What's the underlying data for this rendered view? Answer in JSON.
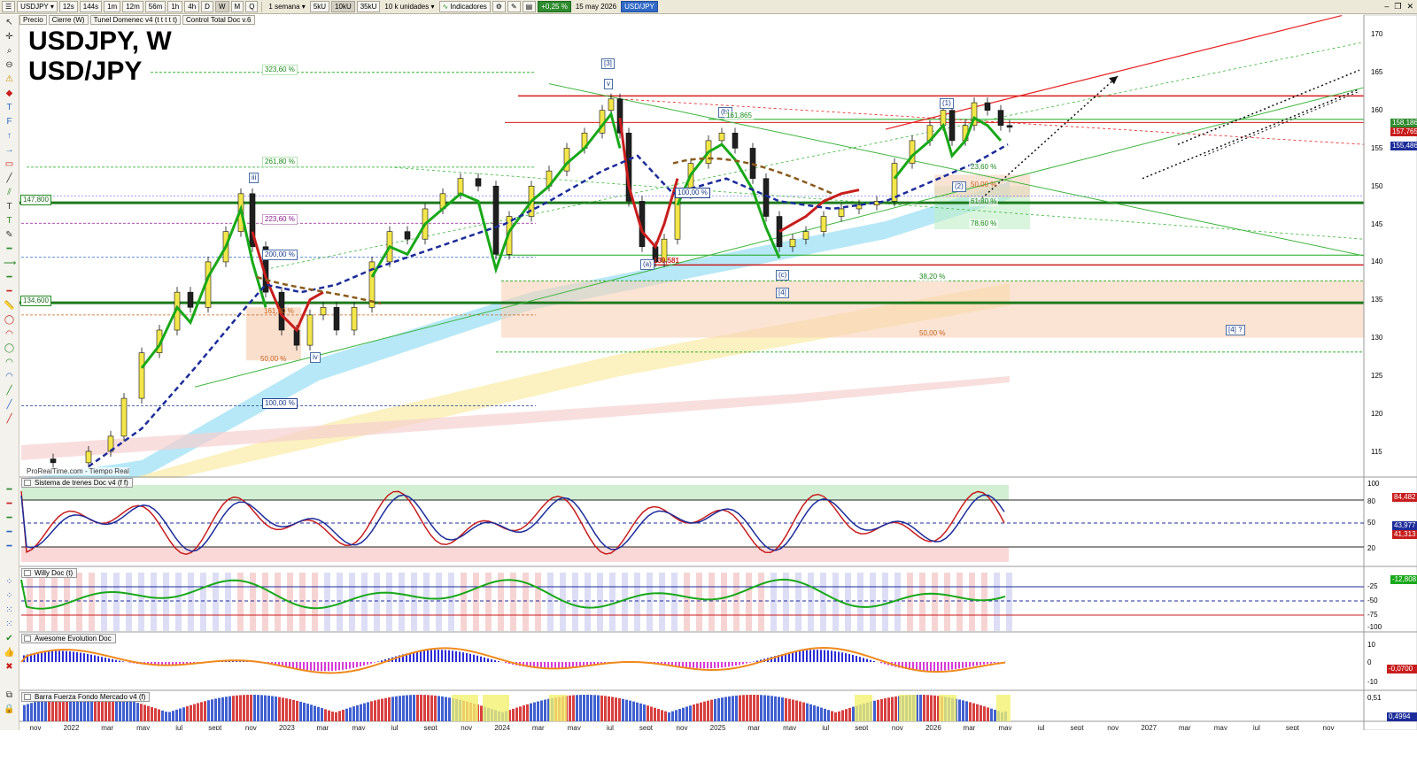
{
  "toolbar": {
    "symbol": "USDJPY",
    "timeframes": [
      "12s",
      "144s",
      "1m",
      "12m",
      "56m",
      "1h",
      "4h",
      "D",
      "W",
      "M",
      "Q"
    ],
    "active_timeframe": "W",
    "period": "1 semana",
    "tick_buttons": [
      "5kU",
      "10kU",
      "35kU"
    ],
    "active_tick": "10kU",
    "units": "10 k unidades",
    "indicators_label": "Indicadores",
    "change_badge": "+0,25 %",
    "date": "15 may 2026",
    "symbol_badge": "USD/JPY",
    "win_controls": [
      "–",
      "❐",
      "✕"
    ]
  },
  "legend": {
    "items": [
      "Precio",
      "Cierre (W)",
      "Tunel Domenec v4 (t t t t t)",
      "Control Total Doc v.6"
    ]
  },
  "title": {
    "line1": "USDJPY, W",
    "line2": "USD/JPY"
  },
  "source_label": "ProRealTime.com - Tiempo Real",
  "colors": {
    "up_candle": "#f3e64a",
    "down_candle": "#1f1f1f",
    "green_line": "#18a818",
    "red_line": "#c81d1d",
    "navy_dash": "#1c2c9a",
    "brown_dash": "#8a5a1c",
    "cyan_band": "#9fe0f5",
    "peach_band": "#f8d2b8",
    "yellow_band": "#fbeeb0",
    "pink_band": "#f7d0d0"
  },
  "price_axis": {
    "ticks": [
      "170",
      "165",
      "160",
      "155",
      "150",
      "145",
      "140",
      "135",
      "130",
      "125",
      "120",
      "115"
    ],
    "current_price_boxes": [
      {
        "value": "158,186",
        "color": "#2e8b2e"
      },
      {
        "value": "157,765",
        "color": "#c81d1d"
      },
      {
        "value": "155,486",
        "color": "#1c2c9a"
      }
    ],
    "level_labels": [
      {
        "value": "147,800",
        "color": "#1c8a1c"
      },
      {
        "value": "134,600",
        "color": "#1c8a1c"
      }
    ]
  },
  "annotations": {
    "waves": [
      "[3]",
      "v",
      "iii",
      "iv",
      "(b)",
      "(a)",
      "(c)",
      "[4]",
      "(1)",
      "(2)",
      "[4] ?"
    ],
    "fib_left": [
      "323,60 %",
      "261,80 %",
      "223,60 %",
      "200,00 %",
      "161,80 %",
      "50,00 %",
      "100,00 %"
    ],
    "fib_mid": [
      "100,00 %",
      "38,20 %",
      "50,00 %",
      "161,865",
      "139,581"
    ],
    "fib_right": [
      "23,60 %",
      "50,00 %",
      "61,80 %",
      "78,60 %"
    ]
  },
  "panels": [
    {
      "title": "Sistema de trenes Doc v4 (f f)",
      "axis": [
        "100",
        "80",
        "50",
        "20"
      ],
      "boxes": [
        {
          "value": "84,482",
          "color": "#c81d1d"
        },
        {
          "value": "41,313",
          "color": "#c81d1d"
        },
        {
          "value": "43,977",
          "color": "#1c2c9a"
        }
      ]
    },
    {
      "title": "Willy Doc (t)",
      "axis": [
        "-25",
        "-50",
        "-75",
        "-100"
      ],
      "boxes": [
        {
          "value": "-12,808",
          "color": "#18a818"
        }
      ]
    },
    {
      "title": "Awesome Evolution Doc",
      "axis": [
        "10",
        "0",
        "-10"
      ],
      "boxes": [
        {
          "value": "-0,0700",
          "color": "#c81d1d"
        }
      ]
    },
    {
      "title": "Barra Fuerza Fondo Mercado v4 (f)",
      "axis": [
        "0,51",
        "0,4994"
      ],
      "boxes": [
        {
          "value": "0,4994",
          "color": "#1c2c9a"
        }
      ]
    }
  ],
  "time_axis": {
    "labels": [
      "nov",
      "2022",
      "mar",
      "may",
      "jul",
      "sept",
      "nov",
      "2023",
      "mar",
      "may",
      "jul",
      "sept",
      "nov",
      "2024",
      "mar",
      "may",
      "jul",
      "sept",
      "nov",
      "2025",
      "mar",
      "may",
      "jul",
      "sept",
      "nov",
      "2026",
      "mar",
      "may",
      "jul",
      "sept",
      "nov",
      "2027",
      "mar",
      "may",
      "jul",
      "sept",
      "nov"
    ]
  }
}
